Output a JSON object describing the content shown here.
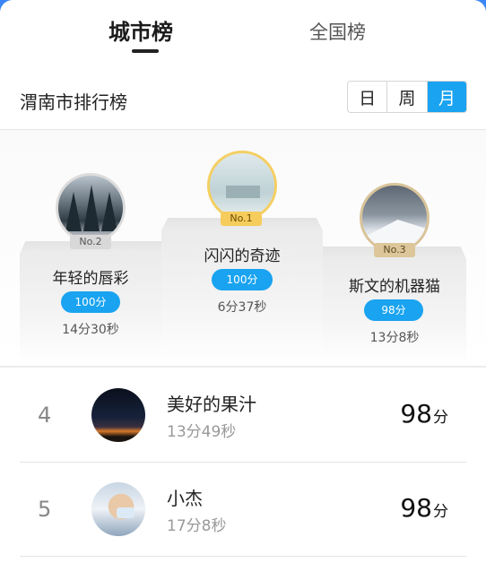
{
  "tabs": {
    "city": "城市榜",
    "country": "全国榜"
  },
  "region_title": "渭南市排行榜",
  "period_toggle": {
    "day": "日",
    "week": "周",
    "month": "月",
    "selected": "月"
  },
  "podium": {
    "first": {
      "badge": "No.1",
      "name": "闪闪的奇迹",
      "score": "100分",
      "time": "6分37秒"
    },
    "second": {
      "badge": "No.2",
      "name": "年轻的唇彩",
      "score": "100分",
      "time": "14分30秒"
    },
    "third": {
      "badge": "No.3",
      "name": "斯文的机器猫",
      "score": "98分",
      "time": "13分8秒"
    }
  },
  "ranking": [
    {
      "rank": "4",
      "name": "美好的果汁",
      "time": "13分49秒",
      "score": "98",
      "unit": "分"
    },
    {
      "rank": "5",
      "name": "小杰",
      "time": "17分8秒",
      "score": "98",
      "unit": "分"
    }
  ],
  "colors": {
    "accent": "#19a3f0",
    "gold": "#f6cc5c",
    "silver": "#d8d8d8",
    "bronze": "#dcc69a"
  }
}
